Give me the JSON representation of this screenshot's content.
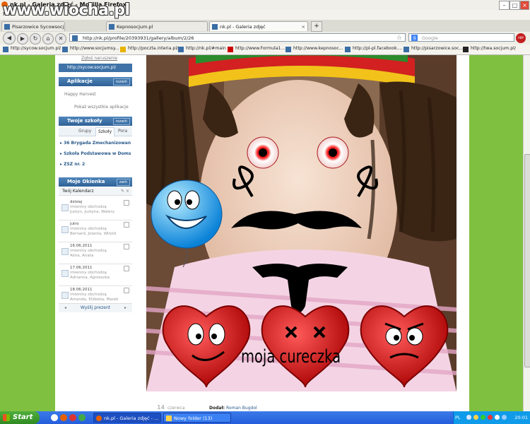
{
  "watermark": "www.wiocha.pl",
  "window": {
    "title": "nk.pl - Galeria zdjęć - Mozilla Firefox"
  },
  "menu": {
    "items": [
      "Plik"
    ]
  },
  "tabs": [
    {
      "label": "Pisarzowice Sycowsocjum"
    },
    {
      "label": "Kepnosocjum.pl"
    },
    {
      "label": "nk.pl - Galeria zdjęć"
    }
  ],
  "nav": {
    "url": "http://nk.pl/profile/20393931/gallery/album/2/26",
    "search_placeholder": "Google",
    "abp": "ABP"
  },
  "bookmarks": [
    "http://sycow.socjum.pl/",
    "http://www.socjumsy...",
    "http://poczta.interia.pl/",
    "http://nk.pl/#main",
    "http://www.Formula1...",
    "http://www.kepnosoc...",
    "http://pl-pl.facebook....",
    "http://pisarzowice.soc...",
    "http://twa.socjum.pl/"
  ],
  "sidebar": {
    "report_link": "Zgłoś naruszenie",
    "profile_link": "http://sycow.socjum.pl/",
    "apps": {
      "title": "Aplikacje",
      "toggle": "rozwiń",
      "item": "Happy Harvest",
      "show_all": "Pokaż wszystkie aplikacje"
    },
    "schools": {
      "title": "Twoje szkoły",
      "toggle": "rozwiń",
      "tabs": [
        "Grupy",
        "Szkoły",
        "Pora"
      ],
      "items": [
        "36 Brygada Zmechanizowan",
        "Szkoła Podstawowa w Doms",
        "ZSZ nr. 2"
      ]
    },
    "calendar": {
      "title": "Moje Okienka",
      "toggle": "zwiń",
      "subtitle": "Twój Kalendarz",
      "entries": [
        {
          "date": "dzisiaj",
          "line2": "imieniny obchodzą",
          "line3": "Justyn, Justyna, Walery"
        },
        {
          "date": "jutro",
          "line2": "imieniny obchodzą",
          "line3": "Bernard, Jolanta, Witold"
        },
        {
          "date": "16.06.2011",
          "line2": "imieniny obchodzą",
          "line3": "Alina, Anata"
        },
        {
          "date": "17.06.2011",
          "line2": "imieniny obchodzą",
          "line3": "Adrianna, Agnieszka"
        },
        {
          "date": "18.06.2011",
          "line2": "imieniny obchodzą",
          "line3": "Amanda, Elżbieta, Marek"
        }
      ],
      "send_gift": "Wyślij prezent"
    }
  },
  "photo": {
    "caption": "moja cureczka",
    "meta_day": "14",
    "meta_month": "czerwca",
    "added_by_label": "Dodał:",
    "added_by": "Roman Bugdol"
  },
  "taskbar": {
    "start": "Start",
    "tasks": [
      "nk.pl - Galeria zdjęć - ...",
      "Nowy folder (13)"
    ],
    "lang": "PL",
    "clock": "20:01"
  }
}
